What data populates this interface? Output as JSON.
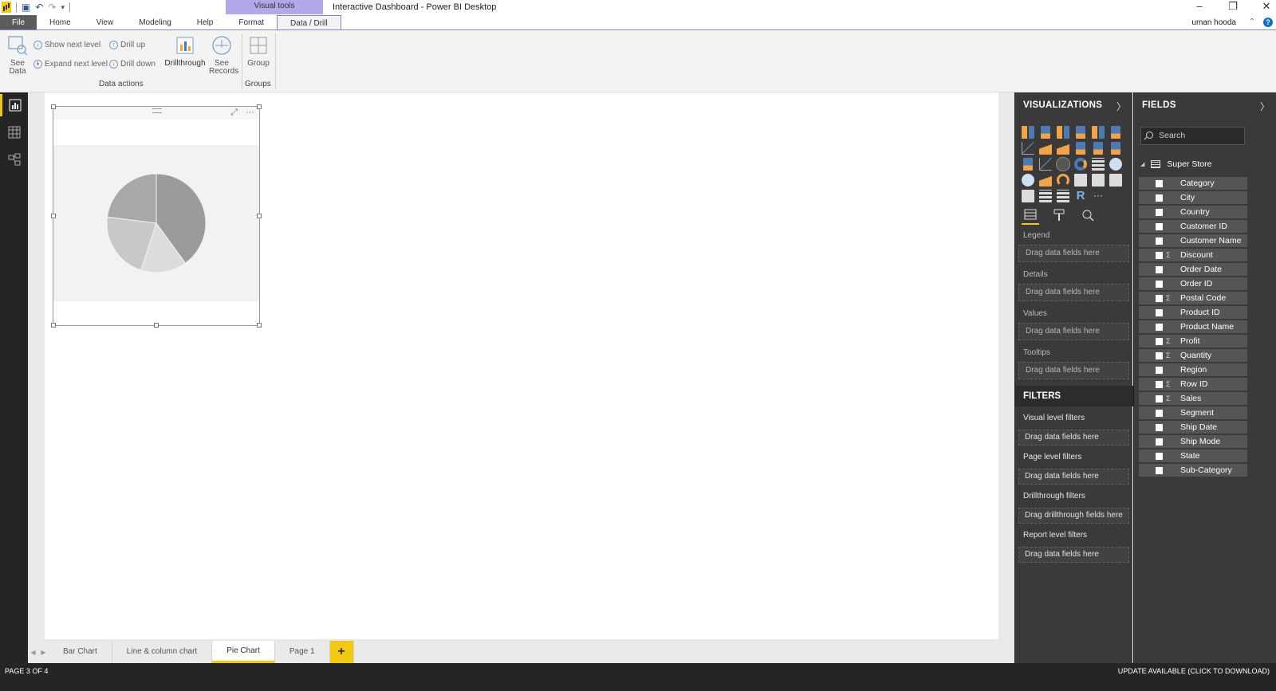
{
  "window": {
    "title": "Interactive Dashboard - Power BI Desktop",
    "context_tab_group": "Visual tools",
    "user": "uman hooda",
    "controls": [
      "–",
      "❐",
      "✕"
    ]
  },
  "ribbon_tabs": [
    "File",
    "Home",
    "View",
    "Modeling",
    "Help",
    "Format",
    "Data / Drill"
  ],
  "ribbon": {
    "see_data": "See Data",
    "show_next_level": "Show next level",
    "expand_next_level": "Expand next level",
    "drill_up": "Drill up",
    "drill_down": "Drill down",
    "drillthrough": "Drillthrough",
    "see_records": "See Records",
    "group": "Group",
    "data_actions_label": "Data actions",
    "groups_label": "Groups"
  },
  "chart_data": {
    "type": "pie",
    "title": "",
    "placeholder": true,
    "slices": [
      {
        "value": 40,
        "color": "#9b9b9b"
      },
      {
        "value": 15,
        "color": "#dcdcdc"
      },
      {
        "value": 22,
        "color": "#c8c8c8"
      },
      {
        "value": 23,
        "color": "#a8a8a8"
      }
    ]
  },
  "page_tabs": [
    "Bar Chart",
    "Line & column chart",
    "Pie Chart",
    "Page 1"
  ],
  "add_page": "+",
  "status": {
    "page": "PAGE 3 OF 4",
    "update": "UPDATE AVAILABLE (CLICK TO DOWNLOAD)"
  },
  "visualizations": {
    "title": "VISUALIZATIONS",
    "wells": [
      {
        "label": "Legend",
        "placeholder": "Drag data fields here"
      },
      {
        "label": "Details",
        "placeholder": "Drag data fields here"
      },
      {
        "label": "Values",
        "placeholder": "Drag data fields here"
      },
      {
        "label": "Tooltips",
        "placeholder": "Drag data fields here"
      }
    ]
  },
  "filters": {
    "title": "FILTERS",
    "sections": [
      {
        "label": "Visual level filters",
        "placeholder": "Drag data fields here"
      },
      {
        "label": "Page level filters",
        "placeholder": "Drag data fields here"
      },
      {
        "label": "Drillthrough filters",
        "placeholder": "Drag drillthrough fields here"
      },
      {
        "label": "Report level filters",
        "placeholder": "Drag data fields here"
      }
    ]
  },
  "fields": {
    "title": "FIELDS",
    "search_placeholder": "Search",
    "table": "Super Store",
    "items": [
      {
        "name": "Category",
        "sigma": false
      },
      {
        "name": "City",
        "sigma": false
      },
      {
        "name": "Country",
        "sigma": false
      },
      {
        "name": "Customer ID",
        "sigma": false
      },
      {
        "name": "Customer Name",
        "sigma": false
      },
      {
        "name": "Discount",
        "sigma": true
      },
      {
        "name": "Order Date",
        "sigma": false
      },
      {
        "name": "Order ID",
        "sigma": false
      },
      {
        "name": "Postal Code",
        "sigma": true
      },
      {
        "name": "Product ID",
        "sigma": false
      },
      {
        "name": "Product Name",
        "sigma": false
      },
      {
        "name": "Profit",
        "sigma": true
      },
      {
        "name": "Quantity",
        "sigma": true
      },
      {
        "name": "Region",
        "sigma": false
      },
      {
        "name": "Row ID",
        "sigma": true
      },
      {
        "name": "Sales",
        "sigma": true
      },
      {
        "name": "Segment",
        "sigma": false
      },
      {
        "name": "Ship Date",
        "sigma": false
      },
      {
        "name": "Ship Mode",
        "sigma": false
      },
      {
        "name": "State",
        "sigma": false
      },
      {
        "name": "Sub-Category",
        "sigma": false
      }
    ]
  }
}
